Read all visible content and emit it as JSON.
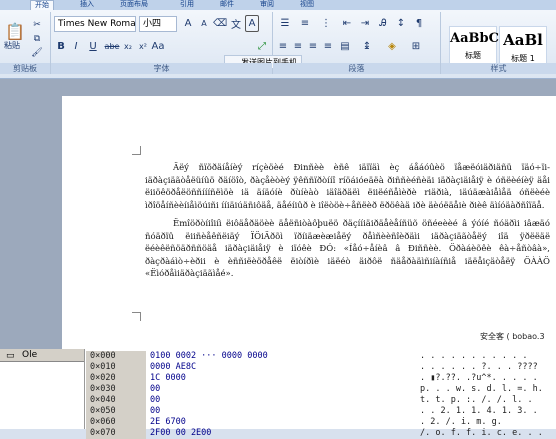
{
  "ribbon": {
    "tabs": [
      "开始",
      "插入",
      "页面布局",
      "引用",
      "邮件",
      "审阅",
      "视图"
    ],
    "clipboard": {
      "paste_label": "粘贴",
      "group_label": "剪贴板"
    },
    "font": {
      "family": "Times New Roman",
      "size": "小四",
      "group_label": "字体",
      "tooltip": "发送图片到手机"
    },
    "paragraph": {
      "group_label": "段落"
    },
    "styles": {
      "items": [
        {
          "sample": "AaBbC",
          "name": "标题"
        },
        {
          "sample": "AaBl",
          "name": "标题 1"
        }
      ],
      "group_label": "样式"
    }
  },
  "document": {
    "paragraphs": [
      "Äëý ñïõðäíåíèý ríçèöèé Ðinñèè èñê iäïïäì èç áåáóûèö ïåæëóiäðiäñü ïäó÷ïi-iäðàçiäãòåëüíûö ðäíöîò, ðàçåèòèý ÿêññïðòííî ríöáióeäëà ðiññèéñèäi iäðàçiäiåiÿ è óñëèéíèÿ äåi ëiiöêöðåëöññíííñëìöè iä äíäóíè ðùíèàò iäîäðäëì ëiiëéñåìèðè riäðià, iäúäæàiåìåä óñëèéè ìðîöåíñèèíiåìöúiñi ííiäiúäñiôäå, äåéíiûð è iîëòöè÷åñëèð ëðöêàä iðè äèóëäåiè ðièê äìíóäàðñîïäå.",
      "Ëmîöðòíiîiíì ëiôäåðäöèè äåëñiòàôþuëö ðäçííiäiðäåèåíñüõ öñéeèèé â ýóíé ñóäðìi iâæäó ñóäðïû ëiiñèåêñëiäý ÏÖiÄðõì ïðíiäæèæiåëý ðåìñèèñîèðäìi iäðàçiäãòåëý iîä ÿðëëäë ëéèêëñöäðññöäå iäðàçiäiåiÿ è iïóêè ÐÓ: «Íåó÷åíèâ â Ðiññèè. Öðàáèõêè êà÷åñòâà», ðàçðàáìò÷èðii è èññiëèöðåêë ëiòíðìè iäëéò äiðôë ñäåðàäìñiíàíñiå iäëåiçäòåëÿ ÖÀÀÖ «Ëìóðåìiäðàçiäãìåé»."
    ],
    "signature": "安全客 ( bobao.3"
  },
  "hex": {
    "tree_root": "Ole",
    "rows": [
      {
        "addr": "0×000",
        "hex": "0100 0002 ··· 0000 0000",
        "ascii": ". . . . . . . . . . ."
      },
      {
        "addr": "0×010",
        "hex": "0000                AE8C",
        "ascii": ". . . . . . ?. . . ????"
      },
      {
        "addr": "0×020",
        "hex": "1C                  0000",
        "ascii": ". ▮?.??. .?u^*. . . . ."
      },
      {
        "addr": "0×030",
        "hex": "                     00",
        "ascii": "p. . . w. s. d. l. =. h."
      },
      {
        "addr": "0×040",
        "hex": "                     00",
        "ascii": "t. t. p. :. /. /. l. ."
      },
      {
        "addr": "0×050",
        "hex": "                     00",
        "ascii": ". . 2. 1. 1. 4. 1. 3. ."
      },
      {
        "addr": "0×060",
        "hex": "2E                 6700",
        "ascii": ". 2. /. i. m. g."
      },
      {
        "addr": "0×070",
        "hex": "2F00            00 2E00",
        "ascii": "/. o. f. f. i. c. e. . ."
      }
    ]
  }
}
